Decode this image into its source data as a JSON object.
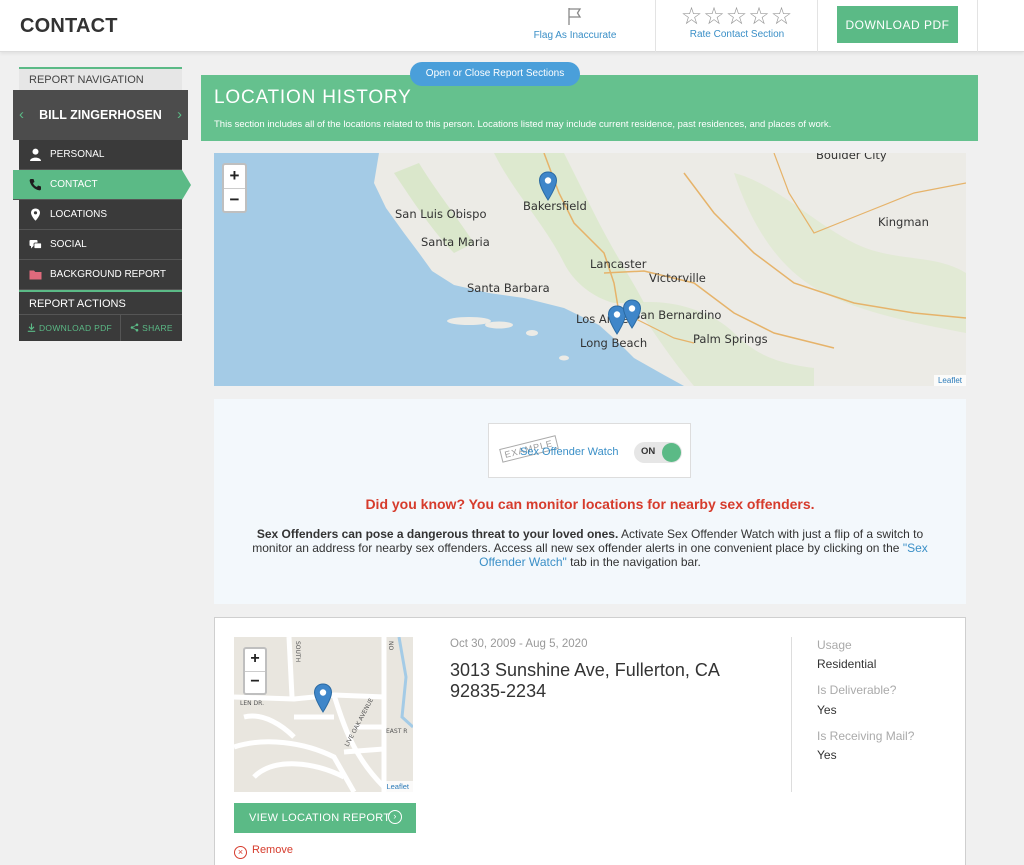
{
  "header": {
    "title": "CONTACT",
    "flag_label": "Flag As Inaccurate",
    "rate_label": "Rate Contact Section",
    "rating_stars": "☆☆☆☆☆",
    "download_label": "DOWNLOAD PDF"
  },
  "sidebar": {
    "nav_heading": "REPORT NAVIGATION",
    "person_name": "BILL ZINGERHOSEN",
    "prev_glyph": "‹",
    "next_glyph": "›",
    "items": [
      {
        "label": "PERSONAL",
        "icon": "person-icon"
      },
      {
        "label": "CONTACT",
        "icon": "phone-icon"
      },
      {
        "label": "LOCATIONS",
        "icon": "map-pin-icon"
      },
      {
        "label": "SOCIAL",
        "icon": "chat-bubbles-icon"
      },
      {
        "label": "BACKGROUND REPORT",
        "icon": "folder-icon"
      }
    ],
    "active_item": "CONTACT",
    "actions_heading": "REPORT ACTIONS",
    "download_pdf": "DOWNLOAD PDF",
    "share": "SHARE"
  },
  "sections_toggle": "Open or Close Report Sections",
  "section": {
    "title": "LOCATION HISTORY",
    "description": "This section includes all of the locations related to this person. Locations listed may include current residence, past residences, and places of work."
  },
  "big_map": {
    "zoom_in": "+",
    "zoom_out": "−",
    "attribution": "Leaflet",
    "labels": [
      "Boulder City",
      "Bakersfield",
      "San Luis Obispo",
      "Kingman",
      "Santa Maria",
      "Lancaster",
      "Victorville",
      "Santa Barbara",
      "Los Angeles",
      "San Bernardino",
      "Long Beach",
      "Palm Springs"
    ],
    "marker_count": 3
  },
  "watch": {
    "example_stamp": "EXAMPLE",
    "label": "Sex Offender Watch",
    "toggle_state": "ON",
    "headline": "Did you know? You can monitor locations for nearby sex offenders.",
    "body_bold": "Sex Offenders can pose a dangerous threat to your loved ones.",
    "body_text": " Activate Sex Offender Watch with just a flip of a switch to monitor an address for nearby sex offenders. Access all new sex offender alerts in one convenient place by clicking on the ",
    "body_link": "\"Sex Offender Watch\"",
    "body_tail": " tab in the navigation bar."
  },
  "location": {
    "date_range": "Oct 30, 2009 - Aug 5, 2020",
    "address": "3013 Sunshine Ave, Fullerton, CA 92835-2234",
    "usage_label": "Usage",
    "usage_value": "Residential",
    "deliverable_label": "Is Deliverable?",
    "deliverable_value": "Yes",
    "receiving_label": "Is Receiving Mail?",
    "receiving_value": "Yes",
    "view_report": "VIEW LOCATION REPORT",
    "remove": "Remove",
    "mini_map_labels": [
      "LEN DR.",
      "LIVE OAK AVENUE",
      "EAST R",
      "SOUTH",
      "NO"
    ],
    "mini_map_attribution": "Leaflet"
  },
  "colors": {
    "accent_green": "#5bba86",
    "section_green": "#65c18e",
    "link_blue": "#3a8fc7",
    "alert_red": "#d63b2c",
    "marker_blue": "#3f86c9"
  }
}
